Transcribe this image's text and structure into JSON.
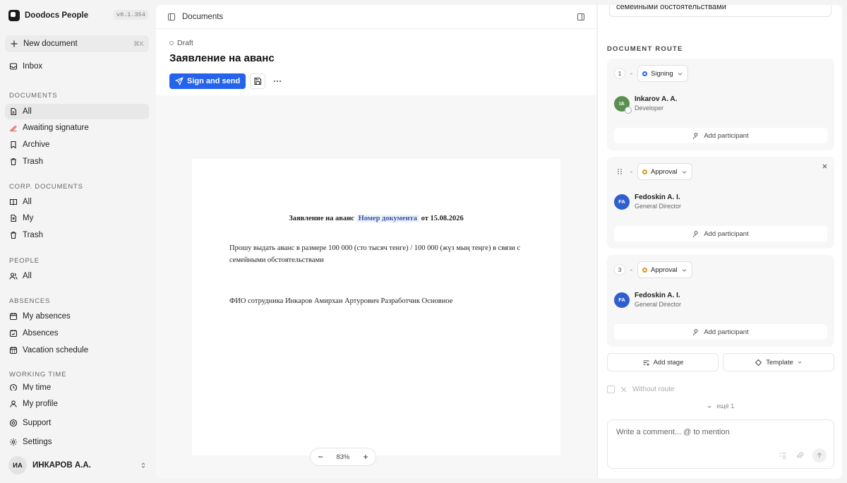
{
  "app": {
    "name": "Doodocs People",
    "version": "v0.1.354"
  },
  "sidebar": {
    "new_document": {
      "label": "New document",
      "shortcut": "⌘K"
    },
    "inbox": "Inbox",
    "sections": [
      {
        "title": "DOCUMENTS",
        "items": [
          "All",
          "Awaiting signature",
          "Archive",
          "Trash"
        ]
      },
      {
        "title": "CORP. DOCUMENTS",
        "items": [
          "All",
          "My",
          "Trash"
        ]
      },
      {
        "title": "PEOPLE",
        "items": [
          "All"
        ]
      },
      {
        "title": "ABSENCES",
        "items": [
          "My absences",
          "Absences",
          "Vacation schedule"
        ]
      },
      {
        "title": "WORKING TIME",
        "items": [
          "My time"
        ]
      }
    ],
    "footer": [
      "My profile",
      "Support",
      "Settings"
    ],
    "user": {
      "initials": "ИА",
      "name": "ИНКАРОВ А.А."
    }
  },
  "main": {
    "breadcrumb": "Documents",
    "status": "Draft",
    "title": "Заявление на аванс",
    "primary_action": "Sign and send",
    "zoom": "83%"
  },
  "document": {
    "title_prefix": "Заявление на аванс",
    "doc_number_placeholder": "Номер документа",
    "title_suffix": "от 15.08.2026",
    "body": "Прошу выдать аванс в размере 100 000 (сто тысяч тенге) / 100 000 (жүз мың теңге) в связи с семейными обстоятельствами",
    "fio": "ФИО сотрудника Инкаров Амирхан Артурович Разработчик Основное"
  },
  "route_panel": {
    "reason_value": "семейными обстоятельствами",
    "heading": "DOCUMENT ROUTE",
    "stages": [
      {
        "number": "1",
        "type": "Signing",
        "type_color": "#2463eb",
        "participant": {
          "initials": "IA",
          "name": "Inkarov A. A.",
          "role": "Developer",
          "color": "#5b8f4f"
        },
        "add_label": "Add participant"
      },
      {
        "number": "",
        "type": "Approval",
        "type_color": "#e3932b",
        "participant": {
          "initials": "FA",
          "name": "Fedoskin A. I.",
          "role": "General Director",
          "color": "#2f5fcf"
        },
        "add_label": "Add participant"
      },
      {
        "number": "3",
        "type": "Approval",
        "type_color": "#e3932b",
        "participant": {
          "initials": "FA",
          "name": "Fedoskin A. I.",
          "role": "General Director",
          "color": "#2f5fcf"
        },
        "add_label": "Add participant"
      }
    ],
    "add_stage": "Add stage",
    "template": "Template",
    "without_route": "Without route",
    "more": "ещё 1",
    "comment_placeholder": "Write a comment... @ to mention"
  }
}
